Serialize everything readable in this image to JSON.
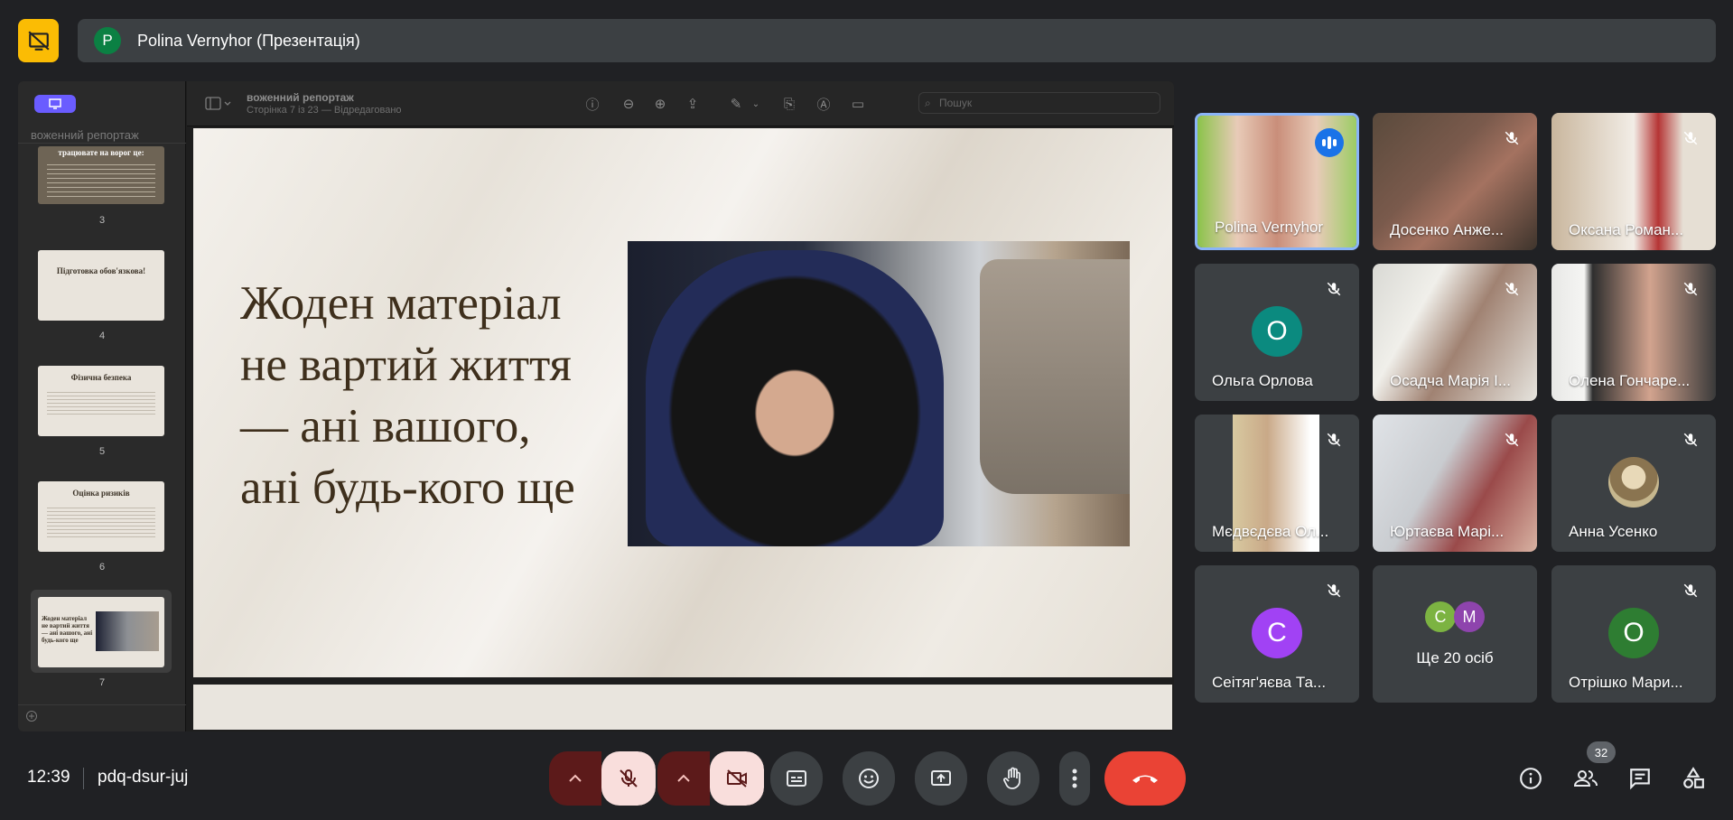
{
  "header": {
    "presenter_avatar_letter": "P",
    "presenter_label": "Polina Vernyhor (Презентація)"
  },
  "viewer": {
    "sidebar_title": "воженний репортаж",
    "doc_title": "воженний репортаж",
    "doc_subtitle": "Сторінка 7 із 23 — Відредаговано",
    "search_placeholder": "Пошук",
    "thumbnails": [
      {
        "num": "3",
        "title": "трацювате на ворог це:"
      },
      {
        "num": "4",
        "title": "Підготовка обов'язкова!"
      },
      {
        "num": "5",
        "title": "Фізична безпека"
      },
      {
        "num": "6",
        "title": "Оцінка ризиків"
      },
      {
        "num": "7",
        "title": "Жоден матеріал не вартий життя — ані вашого, ані будь-кого ще"
      }
    ]
  },
  "slide": {
    "line1": "Жоден матеріал",
    "line2": "не вартий життя",
    "line3": "— ані вашого,",
    "line4": "ані будь-кого ще"
  },
  "participants": [
    {
      "name": "Polina Vernyhor",
      "type": "video",
      "speaking": true
    },
    {
      "name": "Досенко Анже...",
      "type": "video",
      "muted": true
    },
    {
      "name": "Оксана Роман...",
      "type": "video",
      "muted": true
    },
    {
      "name": "Ольга Орлова",
      "type": "avatar",
      "letter": "О",
      "color": "#0b8a7f",
      "muted": true
    },
    {
      "name": "Осадча Марія І...",
      "type": "video",
      "muted": true
    },
    {
      "name": "Олена Гончаре...",
      "type": "video",
      "muted": true
    },
    {
      "name": "Мєдвєдєва Ол...",
      "type": "video",
      "muted": true
    },
    {
      "name": "Юртаєва Марі...",
      "type": "video",
      "muted": true
    },
    {
      "name": "Анна Усенко",
      "type": "photo-avatar",
      "muted": true
    },
    {
      "name": "Сеітяг'яєва Та...",
      "type": "avatar",
      "letter": "С",
      "color": "#a142f4",
      "muted": true
    },
    {
      "name": "Ще 20 осіб",
      "type": "more",
      "letters": [
        "С",
        "М"
      ]
    },
    {
      "name": "Отрішко Мари...",
      "type": "avatar",
      "letter": "О",
      "color": "#2e7d32",
      "muted": true
    }
  ],
  "footer": {
    "time": "12:39",
    "meeting_code": "pdq-dsur-juj",
    "people_count": "32"
  },
  "icons": [
    "present-off-icon",
    "mic-off-icon",
    "camera-off-icon",
    "captions-icon",
    "emoji-icon",
    "present-icon",
    "raise-hand-icon",
    "more-icon",
    "end-call-icon",
    "info-icon",
    "people-icon",
    "chat-icon",
    "activities-icon"
  ]
}
